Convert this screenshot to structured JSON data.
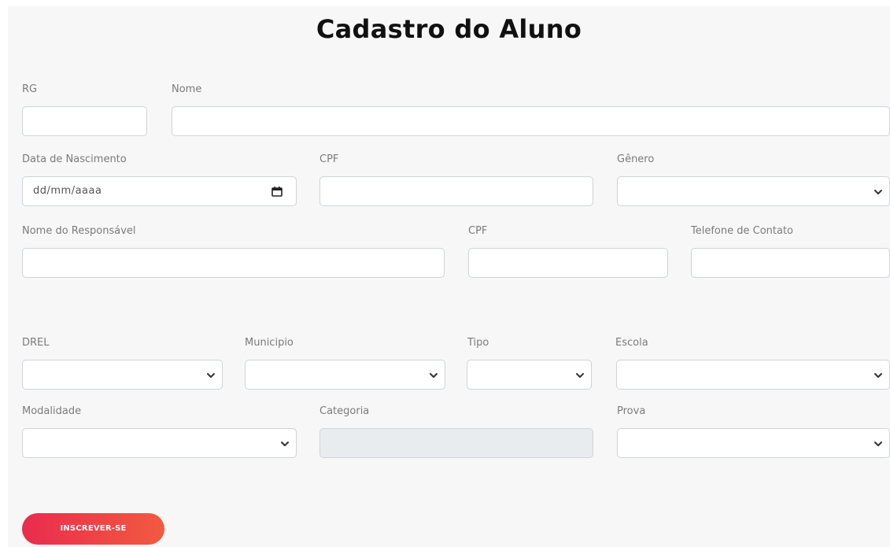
{
  "page": {
    "title": "Cadastro do Aluno"
  },
  "labels": {
    "rg": "RG",
    "nome": "Nome",
    "data_nascimento": "Data de Nascimento",
    "cpf": "CPF",
    "genero": "Gênero",
    "nome_responsavel": "Nome do Responsável",
    "cpf_responsavel": "CPF",
    "telefone": "Telefone de Contato",
    "drel": "DREL",
    "municipio": "Municipio",
    "tipo": "Tipo",
    "escola": "Escola",
    "modalidade": "Modalidade",
    "categoria": "Categoria",
    "prova": "Prova"
  },
  "fields": {
    "data_nascimento_placeholder": "dd/mm/aaaa",
    "rg_value": "",
    "nome_value": "",
    "cpf_value": "",
    "genero_value": "",
    "nome_responsavel_value": "",
    "cpf_responsavel_value": "",
    "telefone_value": "",
    "drel_value": "",
    "municipio_value": "",
    "tipo_value": "",
    "escola_value": "",
    "modalidade_value": "",
    "categoria_value": "",
    "prova_value": ""
  },
  "icons": {
    "date": "calendar-icon",
    "select": "chevron-down-icon"
  },
  "submit": {
    "label": "INSCREVER-SE"
  },
  "colors": {
    "button_start": "#ea2b4e",
    "button_end": "#f25a40",
    "background": "#f7f7f7",
    "disabled_field": "#e9ecef"
  }
}
